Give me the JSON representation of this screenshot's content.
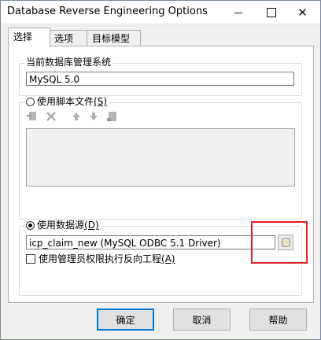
{
  "window": {
    "title": "Database Reverse Engineering Options"
  },
  "titlebar_buttons": {
    "minimize": "—",
    "close": "✕"
  },
  "tabs": [
    {
      "label": "选择"
    },
    {
      "label": "选项"
    },
    {
      "label": "目标模型"
    }
  ],
  "current_dbms": {
    "group_label": "当前数据库管理系统",
    "value": "MySQL 5.0"
  },
  "script_files": {
    "label": "使用脚本文件",
    "shortcut": "(S)",
    "toolbar_icons": [
      "add-file-icon",
      "delete-icon",
      "move-up-icon",
      "move-down-icon",
      "properties-icon"
    ]
  },
  "data_source": {
    "label": "使用数据源",
    "shortcut": "(D)",
    "value": "icp_claim_new (MySQL ODBC 5.1 Driver)",
    "admin_checkbox": "使用管理员权限执行反向工程",
    "admin_shortcut": "(A)"
  },
  "buttons": {
    "ok": "确定",
    "cancel": "取消",
    "help": "帮助"
  },
  "colors": {
    "highlight": "#e02020",
    "accent": "#0078d7"
  }
}
